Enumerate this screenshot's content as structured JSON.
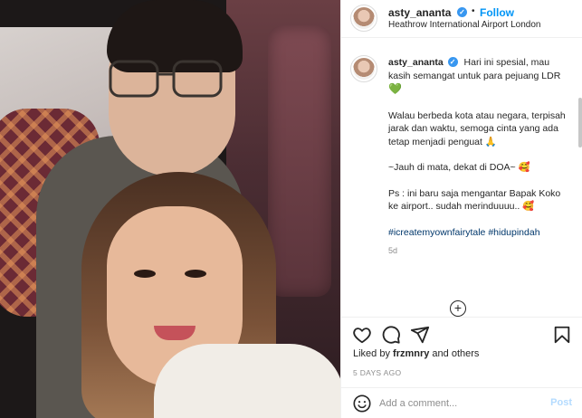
{
  "post": {
    "username": "asty_ananta",
    "follow_label": "Follow",
    "dot": "•",
    "location": "Heathrow International Airport London",
    "verified_glyph": "✓"
  },
  "caption": {
    "username": "asty_ananta",
    "line1": "Hari ini spesial, mau kasih semangat untuk para pejuang LDR",
    "heart": "💚",
    "line2": "Walau berbeda kota atau negara, terpisah jarak dan waktu, semoga cinta yang ada tetap menjadi penguat",
    "pray": "🙏",
    "line3": "~Jauh di mata, dekat di DOA~",
    "smile1": "🥰",
    "line4": "Ps : ini baru saja mengantar Bapak Koko ke airport.. sudah merinduuuu..",
    "smile2": "🥰",
    "hashtag1": "#icreatemyownfairytale",
    "hashtag2": "#hidupindah",
    "time_ago": "5d",
    "load_more": "+"
  },
  "engagement": {
    "liked_prefix": "Liked by ",
    "liked_user": "frzmnry",
    "liked_suffix": " and others",
    "date": "5 DAYS AGO"
  },
  "comment": {
    "placeholder": "Add a comment...",
    "post_label": "Post"
  },
  "icons": [
    "heart-icon",
    "comment-icon",
    "share-icon",
    "bookmark-icon",
    "emoji-icon",
    "add-icon"
  ],
  "colors": {
    "accent": "#0095f6",
    "hashtag": "#00376b",
    "muted": "#8e8e8e",
    "post_disabled": "#b3dbff"
  }
}
